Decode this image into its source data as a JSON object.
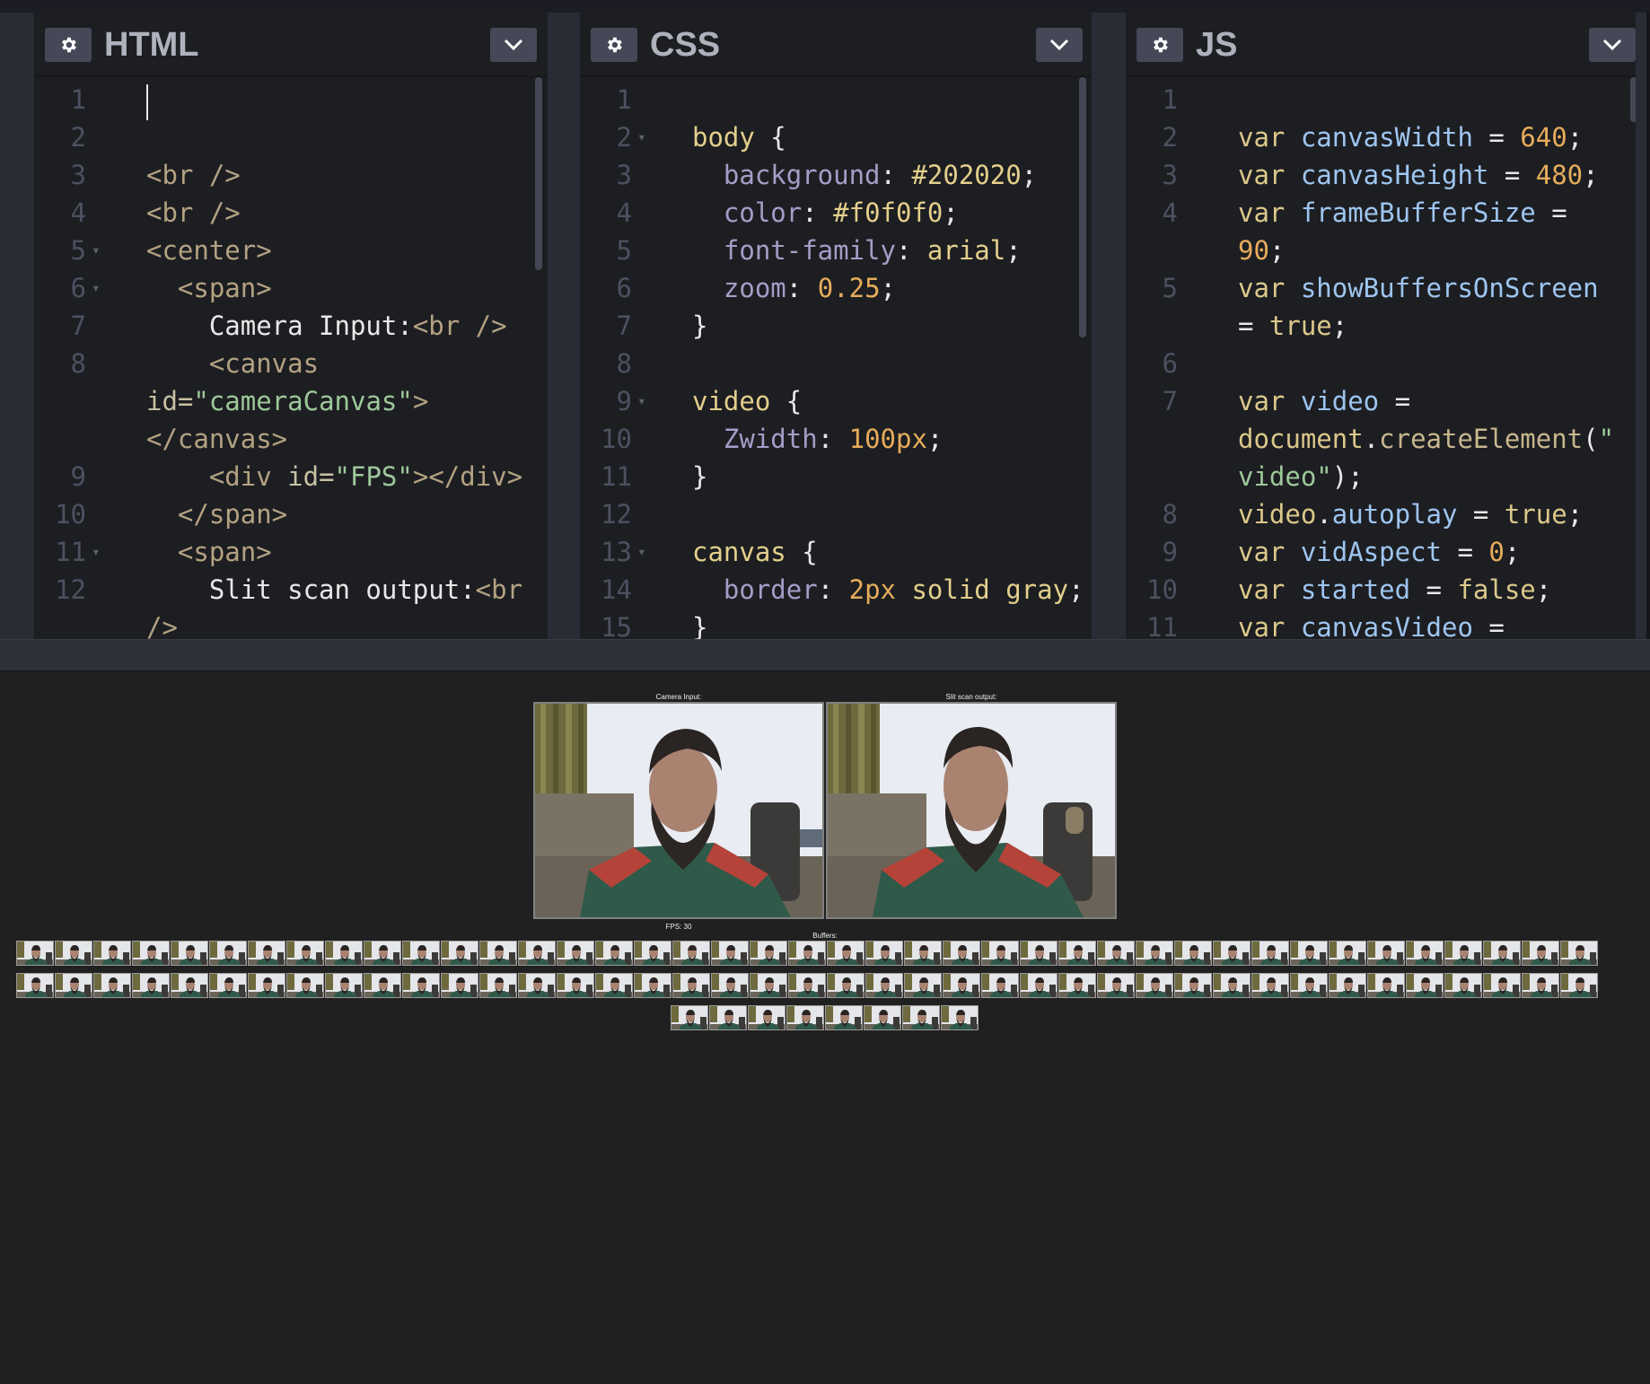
{
  "panes": [
    {
      "id": "html",
      "title": "HTML",
      "lines": [
        {
          "n": "1",
          "fold": false,
          "segs": []
        },
        {
          "n": "2",
          "fold": false,
          "segs": []
        },
        {
          "n": "3",
          "fold": false,
          "segs": [
            [
              "tag",
              "<br />"
            ]
          ]
        },
        {
          "n": "4",
          "fold": false,
          "segs": [
            [
              "tag",
              "<br />"
            ]
          ]
        },
        {
          "n": "5",
          "fold": true,
          "segs": [
            [
              "tag",
              "<center>"
            ]
          ]
        },
        {
          "n": "6",
          "fold": true,
          "segs": [
            [
              "plain",
              "  "
            ],
            [
              "tag",
              "<span>"
            ]
          ]
        },
        {
          "n": "7",
          "fold": false,
          "segs": [
            [
              "plain",
              "    Camera Input:"
            ],
            [
              "tag",
              "<br />"
            ]
          ]
        },
        {
          "n": "8",
          "fold": false,
          "segs": [
            [
              "plain",
              "    "
            ],
            [
              "tag",
              "<canvas"
            ]
          ]
        },
        {
          "n": "",
          "fold": false,
          "segs": [
            [
              "attr",
              "id="
            ],
            [
              "str",
              "\"cameraCanvas\""
            ],
            [
              "tag",
              ">"
            ]
          ]
        },
        {
          "n": "",
          "fold": false,
          "segs": [
            [
              "tag",
              "</canvas>"
            ]
          ]
        },
        {
          "n": "9",
          "fold": false,
          "segs": [
            [
              "plain",
              "    "
            ],
            [
              "tag",
              "<div "
            ],
            [
              "attr",
              "id="
            ],
            [
              "str",
              "\"FPS\""
            ],
            [
              "tag",
              "></div>"
            ]
          ]
        },
        {
          "n": "10",
          "fold": false,
          "segs": [
            [
              "plain",
              "  "
            ],
            [
              "tag",
              "</span>"
            ]
          ]
        },
        {
          "n": "11",
          "fold": true,
          "segs": [
            [
              "plain",
              "  "
            ],
            [
              "tag",
              "<span>"
            ]
          ]
        },
        {
          "n": "12",
          "fold": false,
          "segs": [
            [
              "plain",
              "    Slit scan output:"
            ],
            [
              "tag",
              "<br"
            ]
          ]
        },
        {
          "n": "",
          "fold": false,
          "segs": [
            [
              "tag",
              "/>"
            ]
          ]
        }
      ]
    },
    {
      "id": "css",
      "title": "CSS",
      "lines": [
        {
          "n": "1",
          "fold": false,
          "segs": []
        },
        {
          "n": "2",
          "fold": true,
          "segs": [
            [
              "sel",
              "body"
            ],
            [
              "plain",
              " {"
            ]
          ]
        },
        {
          "n": "3",
          "fold": false,
          "segs": [
            [
              "plain",
              "  "
            ],
            [
              "prop",
              "background"
            ],
            [
              "plain",
              ": "
            ],
            [
              "sel",
              "#202020"
            ],
            [
              "plain",
              ";"
            ]
          ]
        },
        {
          "n": "4",
          "fold": false,
          "segs": [
            [
              "plain",
              "  "
            ],
            [
              "prop",
              "color"
            ],
            [
              "plain",
              ": "
            ],
            [
              "sel",
              "#f0f0f0"
            ],
            [
              "plain",
              ";"
            ]
          ]
        },
        {
          "n": "5",
          "fold": false,
          "segs": [
            [
              "plain",
              "  "
            ],
            [
              "prop",
              "font-family"
            ],
            [
              "plain",
              ": "
            ],
            [
              "sel",
              "arial"
            ],
            [
              "plain",
              ";"
            ]
          ]
        },
        {
          "n": "6",
          "fold": false,
          "segs": [
            [
              "plain",
              "  "
            ],
            [
              "prop",
              "zoom"
            ],
            [
              "plain",
              ": "
            ],
            [
              "val",
              "0.25"
            ],
            [
              "plain",
              ";"
            ]
          ]
        },
        {
          "n": "7",
          "fold": false,
          "segs": [
            [
              "plain",
              "}"
            ]
          ]
        },
        {
          "n": "8",
          "fold": false,
          "segs": []
        },
        {
          "n": "9",
          "fold": true,
          "segs": [
            [
              "sel",
              "video"
            ],
            [
              "plain",
              " {"
            ]
          ]
        },
        {
          "n": "10",
          "fold": false,
          "segs": [
            [
              "plain",
              "  "
            ],
            [
              "prop",
              "Zwidth"
            ],
            [
              "plain",
              ": "
            ],
            [
              "val",
              "100px"
            ],
            [
              "plain",
              ";"
            ]
          ]
        },
        {
          "n": "11",
          "fold": false,
          "segs": [
            [
              "plain",
              "}"
            ]
          ]
        },
        {
          "n": "12",
          "fold": false,
          "segs": []
        },
        {
          "n": "13",
          "fold": true,
          "segs": [
            [
              "sel",
              "canvas"
            ],
            [
              "plain",
              " {"
            ]
          ]
        },
        {
          "n": "14",
          "fold": false,
          "segs": [
            [
              "plain",
              "  "
            ],
            [
              "prop",
              "border"
            ],
            [
              "plain",
              ": "
            ],
            [
              "val",
              "2px"
            ],
            [
              "plain",
              " "
            ],
            [
              "sel",
              "solid gray"
            ],
            [
              "plain",
              ";"
            ]
          ]
        },
        {
          "n": "15",
          "fold": false,
          "segs": [
            [
              "plain",
              "}"
            ]
          ]
        }
      ]
    },
    {
      "id": "js",
      "title": "JS",
      "lines": [
        {
          "n": "1",
          "fold": false,
          "segs": []
        },
        {
          "n": "2",
          "fold": false,
          "segs": [
            [
              "kw",
              "var "
            ],
            [
              "var",
              "canvasWidth"
            ],
            [
              "plain",
              " = "
            ],
            [
              "val",
              "640"
            ],
            [
              "plain",
              ";"
            ]
          ]
        },
        {
          "n": "3",
          "fold": false,
          "segs": [
            [
              "kw",
              "var "
            ],
            [
              "var",
              "canvasHeight"
            ],
            [
              "plain",
              " = "
            ],
            [
              "val",
              "480"
            ],
            [
              "plain",
              ";"
            ]
          ]
        },
        {
          "n": "4",
          "fold": false,
          "segs": [
            [
              "kw",
              "var "
            ],
            [
              "var",
              "frameBufferSize"
            ],
            [
              "plain",
              " ="
            ]
          ]
        },
        {
          "n": "",
          "fold": false,
          "segs": [
            [
              "val",
              "90"
            ],
            [
              "plain",
              ";"
            ]
          ]
        },
        {
          "n": "5",
          "fold": false,
          "segs": [
            [
              "kw",
              "var "
            ],
            [
              "var",
              "showBuffersOnScreen"
            ]
          ]
        },
        {
          "n": "",
          "fold": false,
          "segs": [
            [
              "plain",
              "= "
            ],
            [
              "kw",
              "true"
            ],
            [
              "plain",
              ";"
            ]
          ]
        },
        {
          "n": "6",
          "fold": false,
          "segs": []
        },
        {
          "n": "7",
          "fold": false,
          "segs": [
            [
              "kw",
              "var "
            ],
            [
              "var",
              "video"
            ],
            [
              "plain",
              " ="
            ]
          ]
        },
        {
          "n": "",
          "fold": false,
          "segs": [
            [
              "kw",
              "document"
            ],
            [
              "plain",
              "."
            ],
            [
              "fn",
              "createElement"
            ],
            [
              "plain",
              "("
            ],
            [
              "str",
              "\""
            ]
          ]
        },
        {
          "n": "",
          "fold": false,
          "segs": [
            [
              "str",
              "video\""
            ],
            [
              "plain",
              ");"
            ]
          ]
        },
        {
          "n": "8",
          "fold": false,
          "segs": [
            [
              "kw",
              "video"
            ],
            [
              "plain",
              "."
            ],
            [
              "var",
              "autoplay"
            ],
            [
              "plain",
              " = "
            ],
            [
              "kw",
              "true"
            ],
            [
              "plain",
              ";"
            ]
          ]
        },
        {
          "n": "9",
          "fold": false,
          "segs": [
            [
              "kw",
              "var "
            ],
            [
              "var",
              "vidAspect"
            ],
            [
              "plain",
              " = "
            ],
            [
              "val",
              "0"
            ],
            [
              "plain",
              ";"
            ]
          ]
        },
        {
          "n": "10",
          "fold": false,
          "segs": [
            [
              "kw",
              "var "
            ],
            [
              "var",
              "started"
            ],
            [
              "plain",
              " = "
            ],
            [
              "kw",
              "false"
            ],
            [
              "plain",
              ";"
            ]
          ]
        },
        {
          "n": "11",
          "fold": false,
          "segs": [
            [
              "kw",
              "var "
            ],
            [
              "var",
              "canvasVideo"
            ],
            [
              "plain",
              " ="
            ]
          ]
        }
      ]
    }
  ],
  "preview": {
    "camera_label": "Camera Input:",
    "slit_label": "Slit scan output:",
    "fps_label": "FPS: 30",
    "buffers_label": "Buffers:",
    "buffer_count": 90,
    "buffers_per_row": 41
  },
  "colors": {
    "editor_bg": "#1d1e22",
    "preview_bg": "#202020",
    "button_bg": "#444857"
  }
}
